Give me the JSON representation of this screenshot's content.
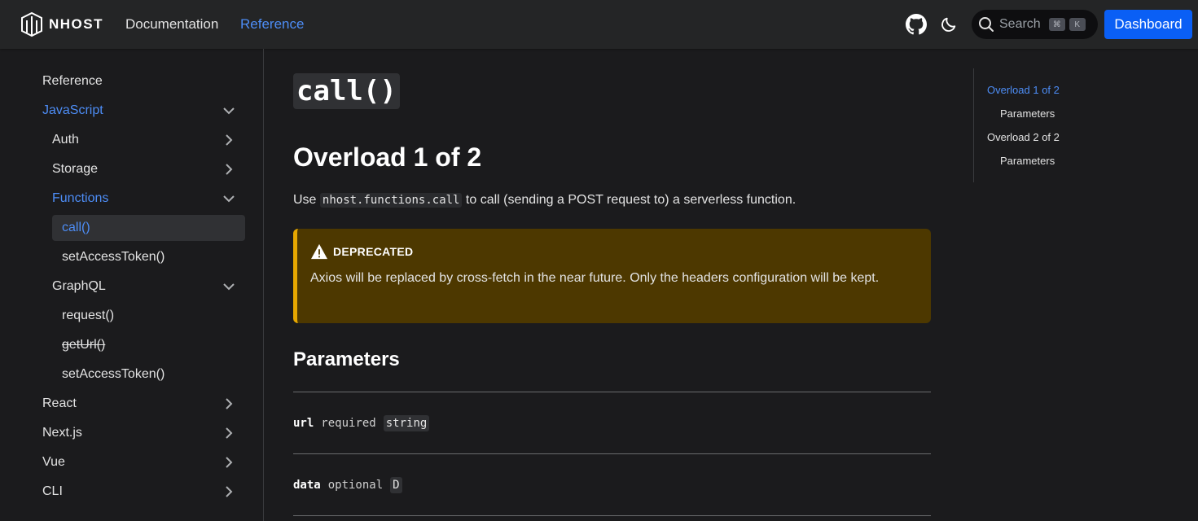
{
  "header": {
    "logo_text": "NHOST",
    "nav": [
      {
        "label": "Documentation",
        "active": false
      },
      {
        "label": "Reference",
        "active": true
      }
    ],
    "search_label": "Search",
    "search_keys": [
      "⌘",
      "K"
    ],
    "dashboard_label": "Dashboard"
  },
  "sidebar": {
    "items": [
      {
        "label": "Reference"
      },
      {
        "label": "JavaScript"
      },
      {
        "label": "Auth"
      },
      {
        "label": "Storage"
      },
      {
        "label": "Functions"
      },
      {
        "label": "call()"
      },
      {
        "label": "setAccessToken()"
      },
      {
        "label": "GraphQL"
      },
      {
        "label": "request()"
      },
      {
        "label": "getUrl()"
      },
      {
        "label": "setAccessToken()"
      },
      {
        "label": "React"
      },
      {
        "label": "Next.js"
      },
      {
        "label": "Vue"
      },
      {
        "label": "CLI"
      }
    ]
  },
  "main": {
    "title": "call()",
    "overload_heading": "Overload 1 of 2",
    "intro_prefix": "Use ",
    "intro_code": "nhost.functions.call",
    "intro_suffix": " to call (sending a POST request to) a serverless function.",
    "admonition": {
      "title": "DEPRECATED",
      "body": "Axios will be replaced by cross-fetch in the near future. Only the headers configuration will be kept."
    },
    "params_heading": "Parameters",
    "params": [
      {
        "name": "url",
        "requirement": "required",
        "type": "string"
      },
      {
        "name": "data",
        "requirement": "optional",
        "type": "D"
      }
    ]
  },
  "toc": {
    "items": [
      {
        "label": "Overload 1 of 2",
        "active": true
      },
      {
        "label": "Parameters"
      },
      {
        "label": "Overload 2 of 2"
      },
      {
        "label": "Parameters"
      }
    ]
  },
  "colors": {
    "accent": "#4d8df6",
    "button": "#0a5ff5",
    "warning_bg": "#4d3800",
    "warning_border": "#e6a700"
  }
}
